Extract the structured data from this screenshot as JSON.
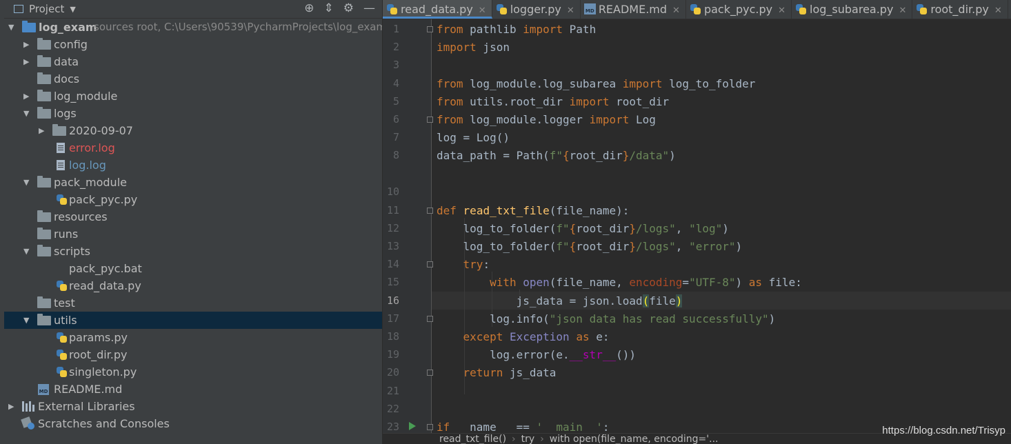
{
  "project_panel": {
    "title": "Project",
    "tools": [
      "target-icon",
      "collapse-icon",
      "gear-icon",
      "minimize-icon"
    ],
    "root": {
      "name": "log_exam",
      "info": "sources root,  C:\\Users\\90539\\PycharmProjects\\log_exam"
    },
    "items": [
      "config",
      "data",
      "docs",
      "log_module",
      "logs",
      "2020-09-07",
      "error.log",
      "log.log",
      "pack_module",
      "pack_pyc.py",
      "resources",
      "runs",
      "scripts",
      "pack_pyc.bat",
      "read_data.py",
      "test",
      "utils",
      "params.py",
      "root_dir.py",
      "singleton.py",
      "README.md",
      "External Libraries",
      "Scratches and Consoles"
    ]
  },
  "tabs": [
    "read_data.py",
    "logger.py",
    "README.md",
    "pack_pyc.py",
    "log_subarea.py",
    "root_dir.py"
  ],
  "editor": {
    "line_numbers": [
      "1",
      "2",
      "3",
      "4",
      "5",
      "6",
      "7",
      "8",
      "10",
      "11",
      "12",
      "13",
      "14",
      "15",
      "16",
      "17",
      "18",
      "19",
      "20",
      "21",
      "22",
      "23"
    ],
    "current_line": "16"
  },
  "breadcrumb": [
    "read_txt_file()",
    "try",
    "with open(file_name, encoding='..."
  ],
  "watermark": "https://blog.csdn.net/Trisyp"
}
